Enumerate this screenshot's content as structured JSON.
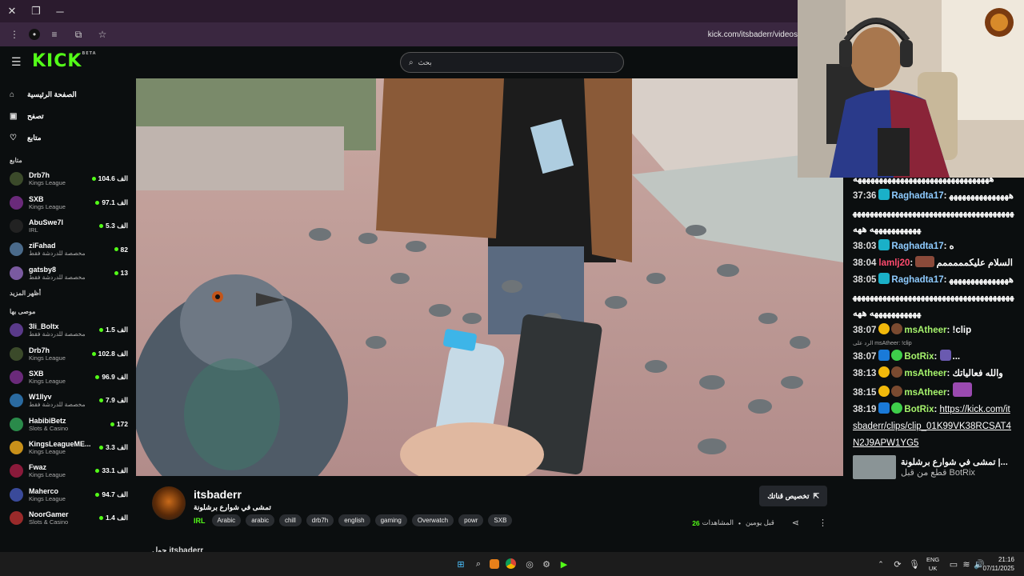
{
  "browser": {
    "url": "kick.com/itsbaderr/videos"
  },
  "header": {
    "logo": "KICK",
    "logo_badge": "BETA",
    "search_placeholder": "بحث"
  },
  "nav": [
    {
      "label": "الصفحة الرئيسية",
      "icon": "home-icon"
    },
    {
      "label": "تصفح",
      "icon": "browse-icon"
    },
    {
      "label": "متابع",
      "icon": "heart-icon"
    }
  ],
  "following": {
    "title": "متابع",
    "items": [
      {
        "name": "Drb7h",
        "category": "Kings League",
        "viewers": "104.6 الف",
        "color": "#3b4a2a"
      },
      {
        "name": "SXB",
        "category": "Kings League",
        "viewers": "97.1 الف",
        "color": "#6a2a7a"
      },
      {
        "name": "AbuSwe7l",
        "category": "IRL",
        "viewers": "5.3 الف",
        "color": "#222"
      },
      {
        "name": "ziFahad",
        "category": "مخصصة للدردشة فقط",
        "viewers": "82",
        "color": "#4a6a8a"
      },
      {
        "name": "gatsby8",
        "category": "مخصصة للدردشة فقط",
        "viewers": "13",
        "color": "#7a5aa0"
      }
    ],
    "show_more": "أظهر المزيد"
  },
  "recommended": {
    "title": "موصى بها",
    "items": [
      {
        "name": "3li_Boltx",
        "category": "مخصصة للدردشة فقط",
        "viewers": "1.5 الف",
        "color": "#5a3a8a"
      },
      {
        "name": "Drb7h",
        "category": "Kings League",
        "viewers": "102.8 الف",
        "color": "#3b4a2a"
      },
      {
        "name": "SXB",
        "category": "Kings League",
        "viewers": "96.9 الف",
        "color": "#6a2a7a"
      },
      {
        "name": "W1llyv",
        "category": "مخصصة للدردشة فقط",
        "viewers": "7.9 الف",
        "color": "#2a6aa0"
      },
      {
        "name": "HabibiBetz",
        "category": "Slots & Casino",
        "viewers": "172",
        "color": "#2a8a4a"
      },
      {
        "name": "KingsLeagueME...",
        "category": "Kings League",
        "viewers": "3.3 الف",
        "color": "#c8901a"
      },
      {
        "name": "Fwaz",
        "category": "Kings League",
        "viewers": "33.1 الف",
        "color": "#8a1a3a"
      },
      {
        "name": "Maherco",
        "category": "Kings League",
        "viewers": "94.7 الف",
        "color": "#3a4a9a"
      },
      {
        "name": "NoorGamer",
        "category": "Slots & Casino",
        "viewers": "1.4 الف",
        "color": "#9a2a2a"
      }
    ]
  },
  "channel": {
    "name": "itsbaderr",
    "title": "تمشى في شوارع برشلونة",
    "category": "IRL",
    "tags": [
      "Arabic",
      "arabic",
      "chill",
      "drb7h",
      "english",
      "gaming",
      "Overwatch",
      "powr",
      "SXB"
    ],
    "clip_button": "تخصيص قناتك",
    "views": "26",
    "views_label": "المشاهدات",
    "time_ago": "قبل يومين",
    "about_heading": "حول itsbaderr"
  },
  "chat": {
    "messages": [
      {
        "time": "",
        "user": "",
        "text": "ههههههههههههههههههههههههههههههههه",
        "user_color": "#ffffff"
      },
      {
        "time": "37:36",
        "user": "Raghadta17",
        "text": "ههههههههههههههههههههههههههههههههههههههههههههههههههههههههههههههههه ههه",
        "user_color": "#8ecbff"
      },
      {
        "time": "38:03",
        "user": "Raghadta17",
        "text": "ه",
        "user_color": "#8ecbff"
      },
      {
        "time": "38:04",
        "user": "lamlj20",
        "text": "السلام عليكمممممم",
        "user_color": "#ff4b6e"
      },
      {
        "time": "38:05",
        "user": "Raghadta17",
        "text": "ههههههههههههههههههههههههههههههههههههههههههههههههههههههههههههههههه ههه",
        "user_color": "#8ecbff"
      },
      {
        "time": "38:07",
        "user": "msAtheer",
        "text": "!clip",
        "user_color": "#a6f36c"
      },
      {
        "time": "38:07",
        "user": "BotRix",
        "text": "...",
        "user_color": "#a6f36c",
        "reply": "الرد على msAtheer: !clip"
      },
      {
        "time": "38:13",
        "user": "msAtheer",
        "text": "والله فعالياتك",
        "user_color": "#a6f36c"
      },
      {
        "time": "38:15",
        "user": "msAtheer",
        "text": "",
        "user_color": "#a6f36c"
      },
      {
        "time": "38:19",
        "user": "BotRix",
        "text": "https://kick.com/itsbaderr/clips/clip_01K99VK38RCSAT4N2J9APW1YG5",
        "user_color": "#a6f36c"
      }
    ],
    "recommend_title": "تمشى في شوارع برشلونة |...",
    "recommend_sub": "قطع من قبل BotRix"
  },
  "taskbar": {
    "lang_top": "ENG",
    "lang_bottom": "UK",
    "time": "21:16",
    "date": "07/11/2025"
  }
}
